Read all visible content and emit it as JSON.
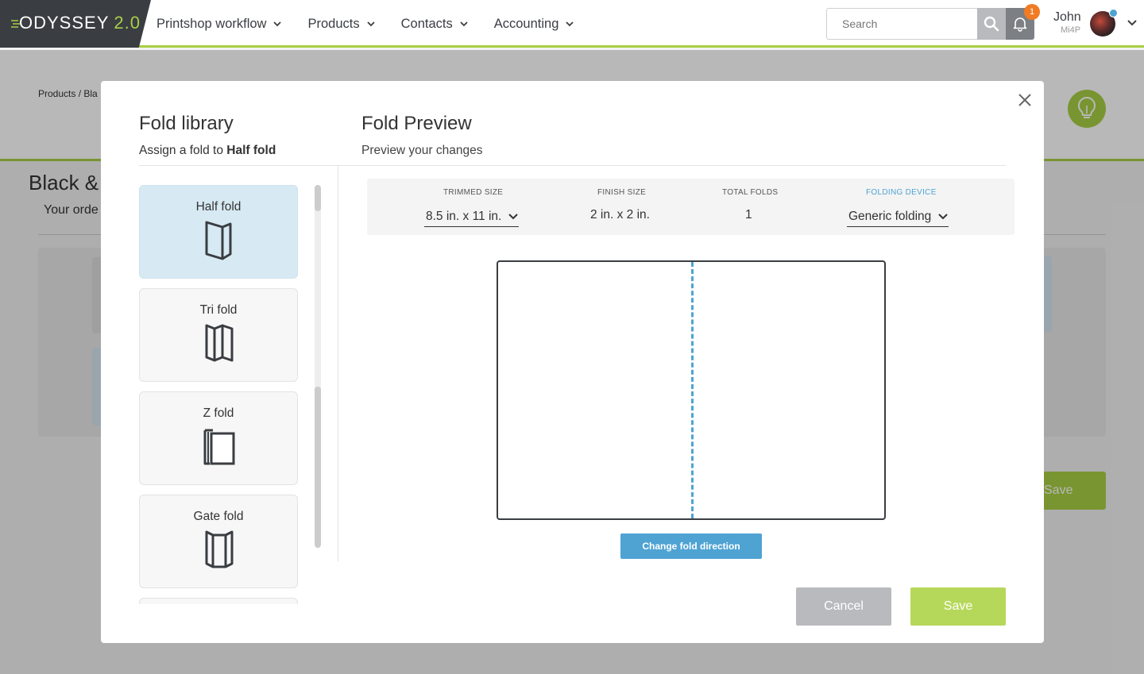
{
  "app": {
    "logo_main": "ODYSSEY",
    "logo_version": "2.0"
  },
  "nav": {
    "items": [
      {
        "label": "Printshop workflow"
      },
      {
        "label": "Products"
      },
      {
        "label": "Contacts"
      },
      {
        "label": "Accounting"
      }
    ]
  },
  "search": {
    "placeholder": "Search"
  },
  "notifications": {
    "count": "1"
  },
  "user": {
    "name": "John",
    "org": "Mi4P"
  },
  "background": {
    "breadcrumb": "Products / Bla",
    "title": "Black &",
    "subtitle": "Your orde",
    "save_label": "Save"
  },
  "modal": {
    "library_title": "Fold library",
    "library_sub_prefix": "Assign a fold to",
    "library_sub_target": "Half fold",
    "preview_title": "Fold Preview",
    "preview_sub": "Preview your changes",
    "folds": [
      {
        "label": "Half fold",
        "icon": "half-fold-icon",
        "selected": true
      },
      {
        "label": "Tri fold",
        "icon": "tri-fold-icon",
        "selected": false
      },
      {
        "label": "Z fold",
        "icon": "z-fold-icon",
        "selected": false
      },
      {
        "label": "Gate fold",
        "icon": "gate-fold-icon",
        "selected": false
      }
    ],
    "specs": {
      "trimmed_size_label": "TRIMMED SIZE",
      "trimmed_size_value": "8.5 in. x 11 in.",
      "finish_size_label": "FINISH SIZE",
      "finish_size_value": "2 in. x 2 in.",
      "total_folds_label": "TOTAL FOLDS",
      "total_folds_value": "1",
      "folding_device_label": "FOLDING DEVICE",
      "folding_device_value": "Generic folding"
    },
    "change_direction_label": "Change fold direction",
    "cancel_label": "Cancel",
    "save_label": "Save"
  },
  "colors": {
    "brand_green": "#a8cf45",
    "accent_blue": "#4ea3d3",
    "badge_orange": "#f07b24",
    "logo_bg": "#3a3d42"
  }
}
